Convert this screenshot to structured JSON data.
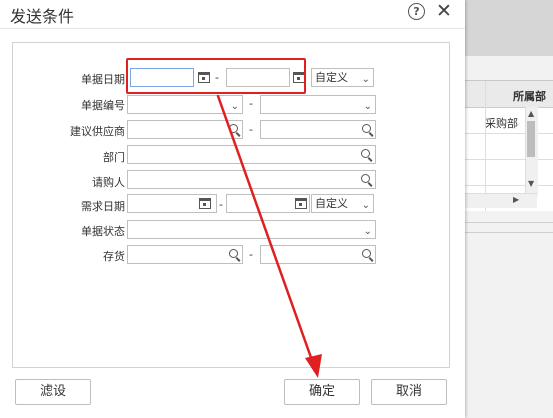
{
  "dialog": {
    "title": "发送条件",
    "help_glyph": "?",
    "close_glyph": "✕"
  },
  "form": {
    "doc_date": {
      "label": "单据日期",
      "from": "",
      "to": "",
      "range_select": "自定义"
    },
    "doc_no": {
      "label": "单据编号",
      "from": "",
      "to": ""
    },
    "supplier": {
      "label": "建议供应商",
      "from": "",
      "to": ""
    },
    "department": {
      "label": "部门",
      "value": ""
    },
    "requester": {
      "label": "请购人",
      "value": ""
    },
    "demand_date": {
      "label": "需求日期",
      "from": "",
      "to": "",
      "range_select": "自定义"
    },
    "doc_status": {
      "label": "单据状态",
      "value": ""
    },
    "inventory": {
      "label": "存货",
      "from": "",
      "to": ""
    },
    "range_dash": "-"
  },
  "buttons": {
    "filter": "滤设",
    "ok": "确定",
    "cancel": "取消"
  },
  "background_grid": {
    "header": "所属部",
    "cell": "采购部"
  },
  "colors": {
    "highlight": "#e02020",
    "focus_border": "#7aa7e6"
  }
}
